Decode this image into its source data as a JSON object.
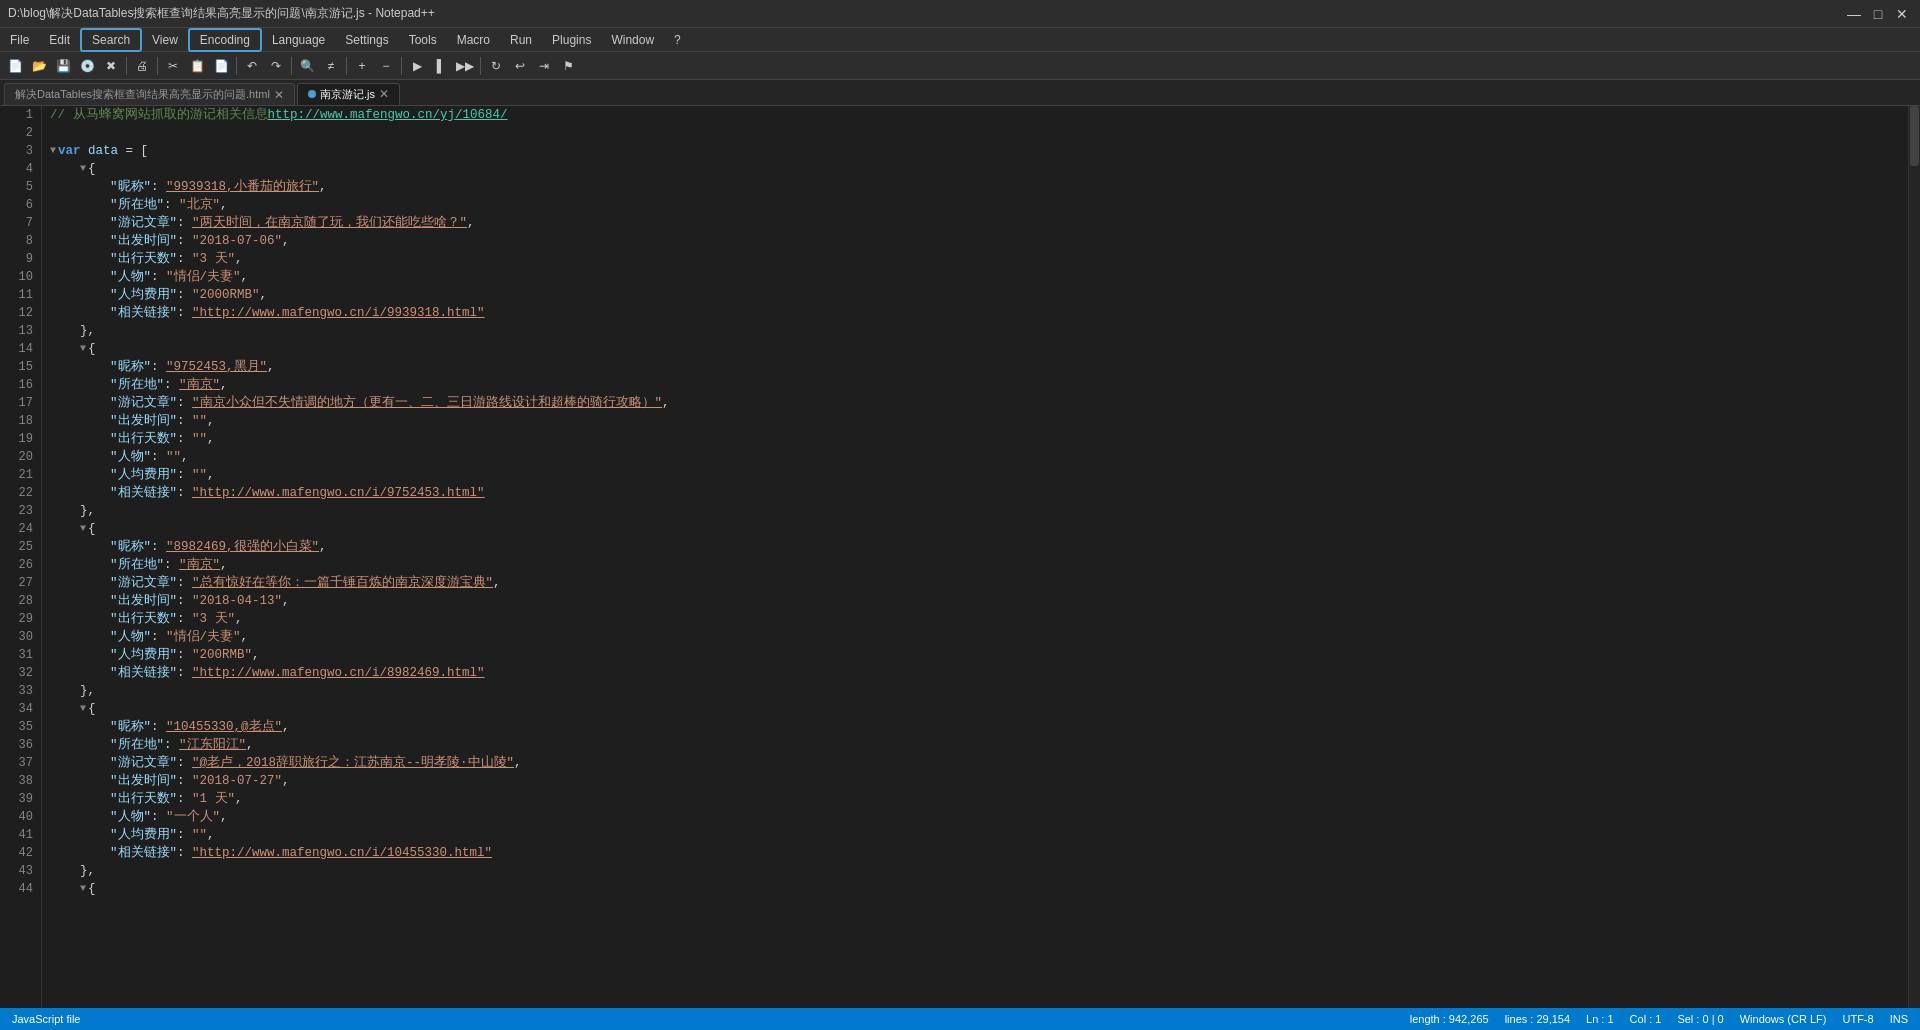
{
  "titlebar": {
    "title": "D:\\blog\\解决DataTables搜索框查询结果高亮显示的问题\\南京游记.js - Notepad++",
    "min": "—",
    "max": "□",
    "close": "✕"
  },
  "menubar": {
    "items": [
      "File",
      "Edit",
      "Search",
      "View",
      "Encoding",
      "Language",
      "Settings",
      "Tools",
      "Macro",
      "Run",
      "Plugins",
      "Window",
      "?"
    ]
  },
  "tabs": [
    {
      "label": "解决DataTables搜索框查询结果高亮显示的问题.html",
      "active": false
    },
    {
      "label": "南京游记.js",
      "active": true
    }
  ],
  "statusbar": {
    "left": "JavaScript file",
    "length": "length : 942,265",
    "lines": "lines : 29,154",
    "ln": "Ln : 1",
    "col": "Col : 1",
    "sel": "Sel : 0 | 0",
    "lineending": "Windows (CR LF)",
    "encoding": "UTF-8",
    "ins": "INS"
  },
  "code": {
    "line1_comment": "// 从马蜂窝网站抓取的游记相关信息http://www.mafengwo.cn/yj/10684/",
    "lines": [
      {
        "n": 1,
        "text": "comment",
        "content": "// 从马蜂窝网站抓取的游记相关信息http://www.mafengwo.cn/yj/10684/"
      },
      {
        "n": 2,
        "text": "empty"
      },
      {
        "n": 3,
        "text": "var_decl",
        "content": "var data = ["
      },
      {
        "n": 4,
        "text": "indent0",
        "content": "{"
      },
      {
        "n": 5,
        "text": "key_val",
        "key": "昵称",
        "val": "\"9939318,小番茄的旅行\""
      },
      {
        "n": 6,
        "text": "key_val",
        "key": "所在地",
        "val": "\"北京\""
      },
      {
        "n": 7,
        "text": "key_val_link",
        "key": "游记文章",
        "val": "\"两天时间，在南京随了玩，我们还能吃些啥？\""
      },
      {
        "n": 8,
        "text": "key_val",
        "key": "出发时间",
        "val": "\"2018-07-06\""
      },
      {
        "n": 9,
        "text": "key_val",
        "key": "出行天数",
        "val": "\"3 天\""
      },
      {
        "n": 10,
        "text": "key_val",
        "key": "人物",
        "val": "\"情侣/夫妻\""
      },
      {
        "n": 11,
        "text": "key_val",
        "key": "人均费用",
        "val": "\"2000RMB\""
      },
      {
        "n": 12,
        "text": "key_val_url",
        "key": "相关链接",
        "url": "http://www.mafengwo.cn/i/9939318.html"
      },
      {
        "n": 13,
        "text": "close_obj"
      },
      {
        "n": 14,
        "text": "indent0",
        "content": "{"
      },
      {
        "n": 15,
        "text": "key_val",
        "key": "昵称",
        "val": "\"9752453,黑月\""
      },
      {
        "n": 16,
        "text": "key_val_link2",
        "key": "所在地",
        "val": "\"南京\""
      },
      {
        "n": 17,
        "text": "key_val_link",
        "key": "游记文章",
        "val": "\"南京小众但不失情调的地方（更有一、二、三日游路线设计和超棒的骑行攻略）\""
      },
      {
        "n": 18,
        "text": "key_val",
        "key": "出发时间",
        "val": "\"\""
      },
      {
        "n": 19,
        "text": "key_val",
        "key": "出行天数",
        "val": "\"\""
      },
      {
        "n": 20,
        "text": "key_val",
        "key": "人物",
        "val": "\"\""
      },
      {
        "n": 21,
        "text": "key_val",
        "key": "人均费用",
        "val": "\"\""
      },
      {
        "n": 22,
        "text": "key_val_url",
        "key": "相关链接",
        "url": "http://www.mafengwo.cn/i/9752453.html"
      },
      {
        "n": 23,
        "text": "close_obj"
      },
      {
        "n": 24,
        "text": "indent0",
        "content": "{"
      },
      {
        "n": 25,
        "text": "key_val",
        "key": "昵称",
        "val": "\"8982469,很强的小白菜\""
      },
      {
        "n": 26,
        "text": "key_val_link2",
        "key": "所在地",
        "val": "\"南京\""
      },
      {
        "n": 27,
        "text": "key_val_link",
        "key": "游记文章",
        "val": "\"总有惊好在等你：一篇千锤百炼的南京深度游宝典\""
      },
      {
        "n": 28,
        "text": "key_val",
        "key": "出发时间",
        "val": "\"2018-04-13\""
      },
      {
        "n": 29,
        "text": "key_val",
        "key": "出行天数",
        "val": "\"3 天\""
      },
      {
        "n": 30,
        "text": "key_val",
        "key": "人物",
        "val": "\"情侣/夫妻\""
      },
      {
        "n": 31,
        "text": "key_val",
        "key": "人均费用",
        "val": "\"200RMB\""
      },
      {
        "n": 32,
        "text": "key_val_url",
        "key": "相关链接",
        "url": "http://www.mafengwo.cn/i/8982469.html"
      },
      {
        "n": 33,
        "text": "close_obj"
      },
      {
        "n": 34,
        "text": "indent0",
        "content": "{"
      },
      {
        "n": 35,
        "text": "key_val",
        "key": "昵称",
        "val": "\"10455330,@老点\""
      },
      {
        "n": 36,
        "text": "key_val_link2",
        "key": "所在地",
        "val": "\"江东阳江\""
      },
      {
        "n": 37,
        "text": "key_val_link",
        "key": "游记文章",
        "val": "\"@老卢，2018辞职旅行之：江苏南京--明孝陵·中山陵\""
      },
      {
        "n": 38,
        "text": "key_val",
        "key": "出发时间",
        "val": "\"2018-07-27\""
      },
      {
        "n": 39,
        "text": "key_val",
        "key": "出行天数",
        "val": "\"1 天\""
      },
      {
        "n": 40,
        "text": "key_val",
        "key": "人物",
        "val": "\"一个人\""
      },
      {
        "n": 41,
        "text": "key_val",
        "key": "人均费用",
        "val": "\"\""
      },
      {
        "n": 42,
        "text": "key_val_url",
        "key": "相关链接",
        "url": "http://www.mafengwo.cn/i/10455330.html"
      },
      {
        "n": 43,
        "text": "close_obj"
      },
      {
        "n": 44,
        "text": "indent0",
        "content": "{"
      }
    ]
  }
}
